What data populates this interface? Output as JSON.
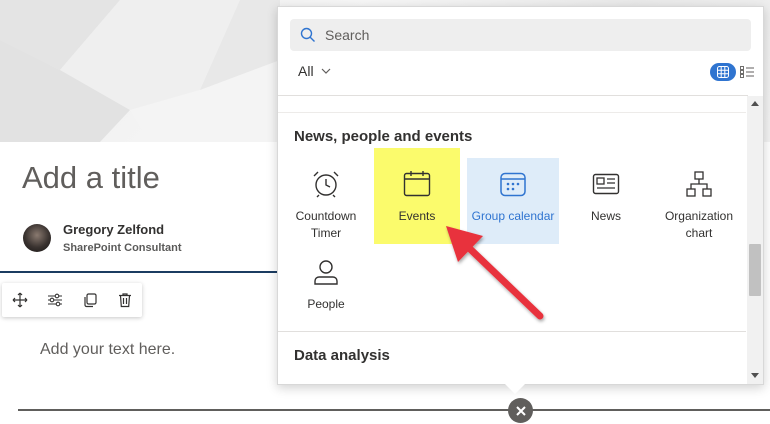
{
  "page": {
    "title": "Add a title",
    "author": {
      "name": "Gregory Zelfond",
      "role": "SharePoint Consultant"
    },
    "text_placeholder": "Add your text here."
  },
  "edit_toolbar": {
    "buttons": [
      {
        "icon": "move-icon"
      },
      {
        "icon": "edit-properties-icon"
      },
      {
        "icon": "duplicate-icon"
      },
      {
        "icon": "delete-icon"
      }
    ]
  },
  "toolbox": {
    "search": {
      "placeholder": "Search",
      "value": ""
    },
    "filter": {
      "selected": "All"
    },
    "view": {
      "active": "grid",
      "options": [
        "grid",
        "list"
      ]
    },
    "sections": [
      {
        "heading": "News, people and events",
        "items": [
          {
            "label": "Countdown Timer",
            "icon": "alarm-clock-icon"
          },
          {
            "label": "Events",
            "icon": "calendar-icon",
            "highlighted": true
          },
          {
            "label": "Group calendar",
            "icon": "group-calendar-icon",
            "selected": true
          },
          {
            "label": "News",
            "icon": "newspaper-icon"
          },
          {
            "label": "Organization chart",
            "icon": "org-chart-icon"
          },
          {
            "label": "People",
            "icon": "person-icon"
          }
        ]
      },
      {
        "heading": "Data analysis",
        "items": []
      }
    ]
  },
  "colors": {
    "accent": "#2f74d0",
    "selected_tile": "#deecf9",
    "highlight": "#fbfb6c",
    "annotation_arrow": "#e8333c",
    "title_rule": "#1b3c61"
  }
}
